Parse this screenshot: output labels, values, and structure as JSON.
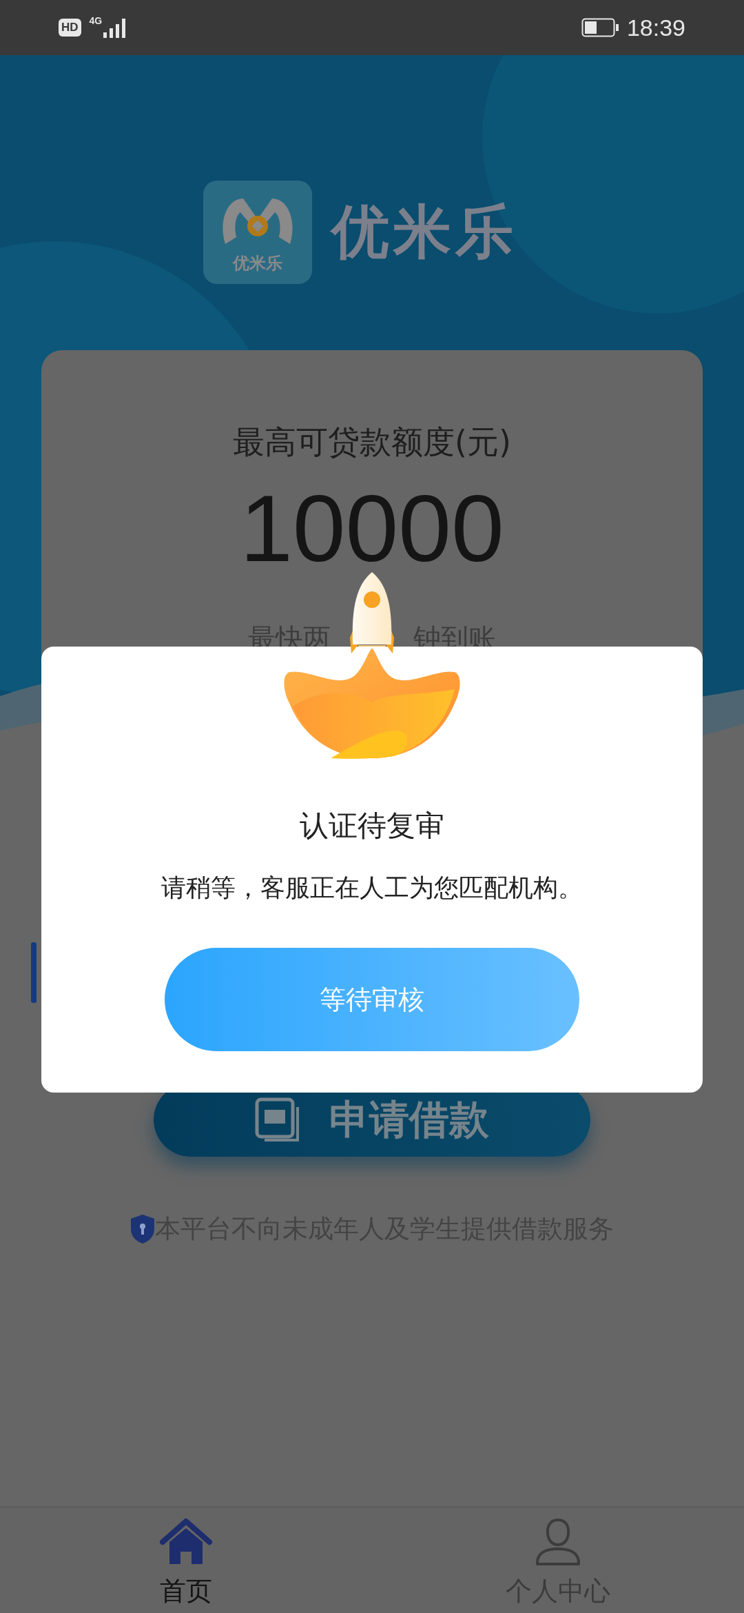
{
  "status_bar": {
    "badge": "HD",
    "network": "4G",
    "time": "18:39"
  },
  "brand": {
    "icon_label": "优米乐",
    "name": "优米乐"
  },
  "card": {
    "title": "最高可贷款额度(元)",
    "amount": "10000",
    "subtitle_parts": [
      "最快两",
      "钟到账"
    ]
  },
  "apply_button": {
    "label": "申请借款"
  },
  "notice": "本平台不向未成年人及学生提供借款服务",
  "dialog": {
    "title": "认证待复审",
    "message": "请稍等，客服正在人工为您匹配机构。",
    "button": "等待审核"
  },
  "tab_bar": [
    {
      "label": "首页",
      "kind": "home",
      "selected": true
    },
    {
      "label": "个人中心",
      "kind": "person",
      "selected": false
    }
  ]
}
